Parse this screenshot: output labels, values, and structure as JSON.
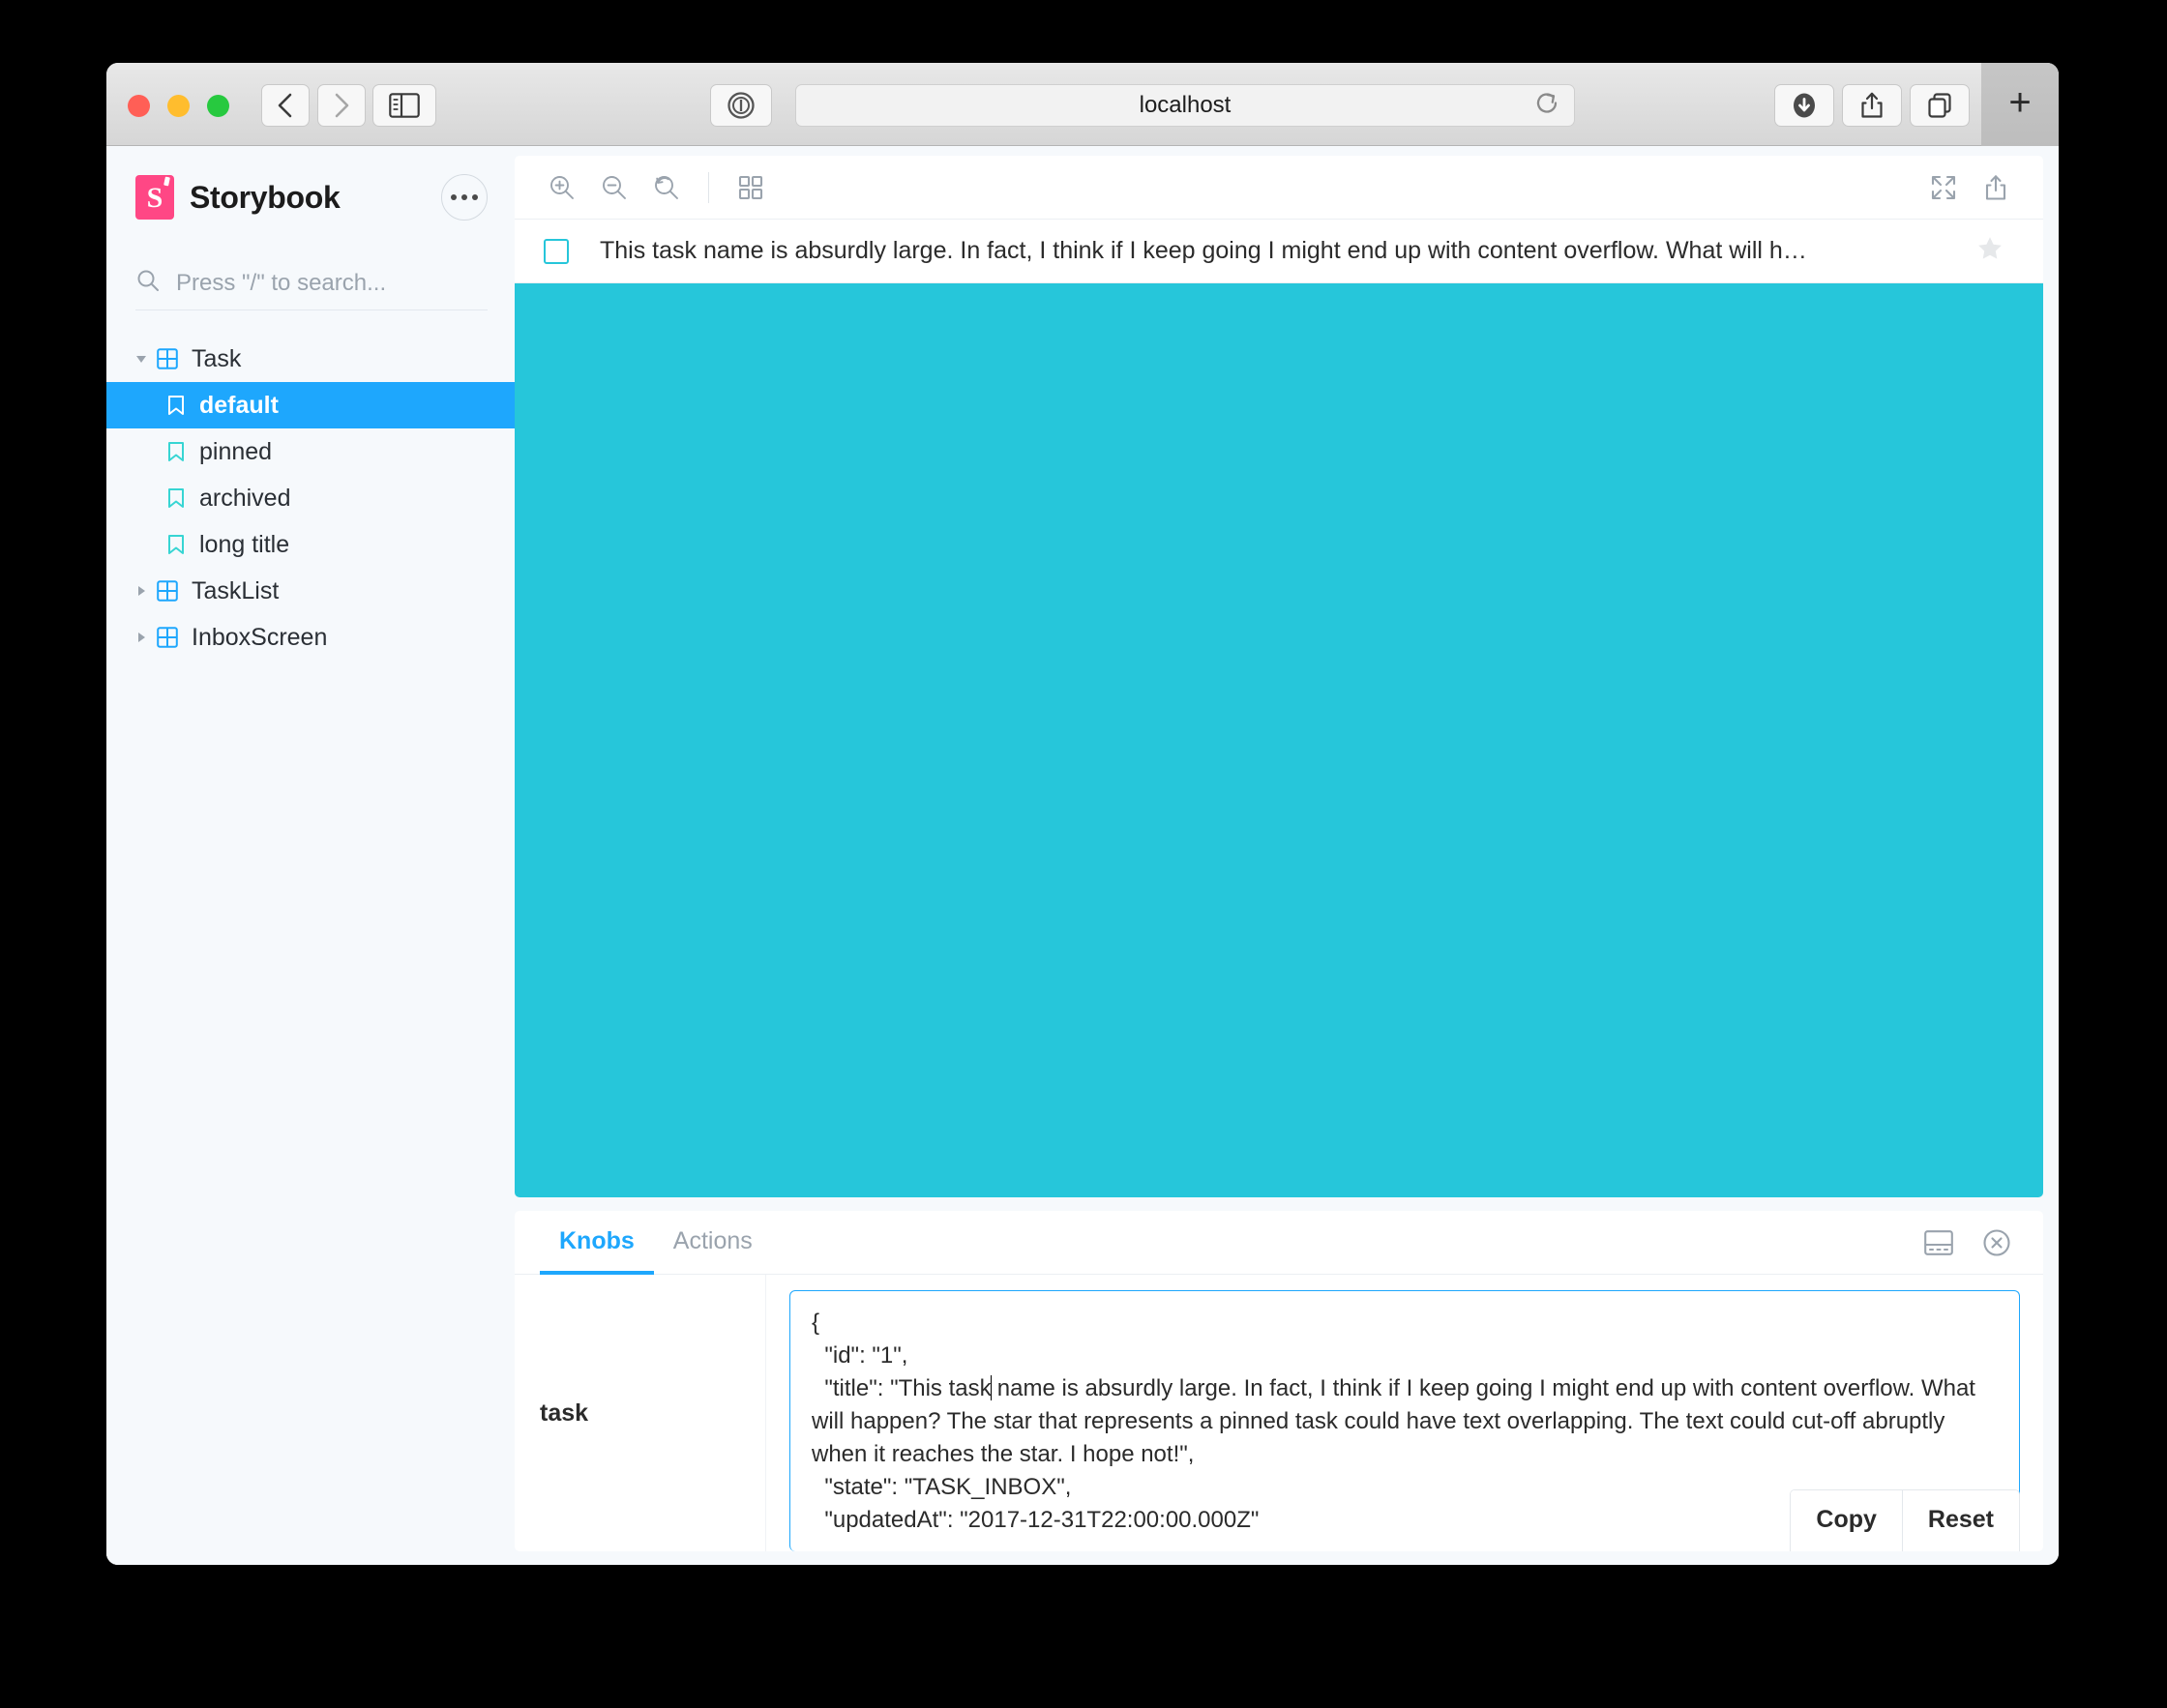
{
  "browser": {
    "url": "localhost",
    "buttons": {
      "back": "Back",
      "forward": "Forward",
      "sidebar": "Show sidebar",
      "reader": "Reader view",
      "reload": "Reload",
      "downloads": "Downloads",
      "share": "Share",
      "tab_overview": "Tab overview",
      "new_tab": "+"
    }
  },
  "sidebar": {
    "brand": "Storybook",
    "menu_button": "•••",
    "search": {
      "placeholder": "Press \"/\" to search...",
      "value": ""
    },
    "tree": [
      {
        "label": "Task",
        "type": "component",
        "depth": 0,
        "expanded": true,
        "selected": false
      },
      {
        "label": "default",
        "type": "story",
        "depth": 1,
        "expanded": null,
        "selected": true
      },
      {
        "label": "pinned",
        "type": "story",
        "depth": 1,
        "expanded": null,
        "selected": false
      },
      {
        "label": "archived",
        "type": "story",
        "depth": 1,
        "expanded": null,
        "selected": false
      },
      {
        "label": "long title",
        "type": "story",
        "depth": 1,
        "expanded": null,
        "selected": false
      },
      {
        "label": "TaskList",
        "type": "component",
        "depth": 0,
        "expanded": false,
        "selected": false
      },
      {
        "label": "InboxScreen",
        "type": "component",
        "depth": 0,
        "expanded": false,
        "selected": false
      }
    ]
  },
  "canvas": {
    "toolbar": {
      "zoom_in": "Zoom in",
      "zoom_out": "Zoom out",
      "zoom_reset": "Reset zoom",
      "grid": "Change background",
      "fullscreen": "Go full screen",
      "open_new_tab": "Open canvas in new tab"
    },
    "story": {
      "title": "This task name is absurdly large. In fact, I think if I keep going I might end up with content overflow. What will h…",
      "checkbox_checked": false,
      "starred": false
    },
    "background_color": "#26c6da"
  },
  "addons": {
    "tabs": [
      {
        "label": "Knobs",
        "active": true
      },
      {
        "label": "Actions",
        "active": false
      }
    ],
    "tools": {
      "layout": "Change addon panel position",
      "close": "Hide addon panel"
    },
    "knobs": {
      "name": "task",
      "json_before_caret": "{\n  \"id\": \"1\",\n  \"title\": \"This task",
      "json_after_caret": " name is absurdly large. In fact, I think if I keep going I might end up with content overflow. What will happen? The star that represents a pinned task could have text overlapping. The text could cut-off abruptly when it reaches the star. I hope not!\",\n  \"state\": \"TASK_INBOX\",\n  \"updatedAt\": \"2017-12-31T22:00:00.000Z\"",
      "copy_label": "Copy",
      "reset_label": "Reset"
    }
  },
  "colors": {
    "accent_blue": "#1ea7fd",
    "brand_pink": "#ff4785",
    "story_icon": "#37d5d3",
    "canvas_cyan": "#26c6da"
  }
}
